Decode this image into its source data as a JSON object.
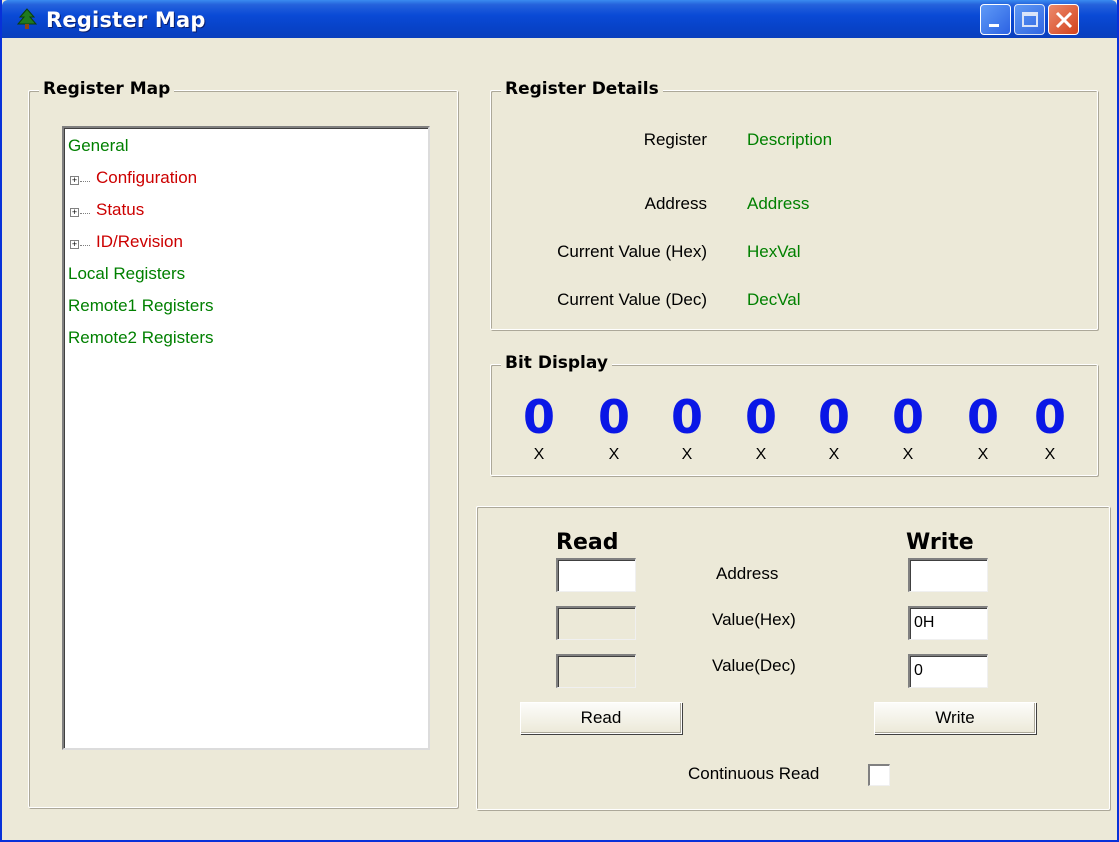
{
  "window": {
    "title": "Register Map"
  },
  "titlebar": {
    "icons": [
      "tree-icon",
      "minimize-icon",
      "maximize-icon",
      "close-icon"
    ]
  },
  "register_map": {
    "label": "Register Map",
    "tree": [
      {
        "text": "General",
        "color": "#008000"
      },
      {
        "text": "Configuration",
        "color": "#cc0000"
      },
      {
        "text": "Status",
        "color": "#cc0000"
      },
      {
        "text": "ID/Revision",
        "color": "#cc0000"
      },
      {
        "text": "Local Registers",
        "color": "#008000"
      },
      {
        "text": "Remote1 Registers",
        "color": "#008000"
      },
      {
        "text": "Remote2 Registers",
        "color": "#008000"
      }
    ]
  },
  "register_details": {
    "label": "Register Details",
    "rows": [
      {
        "label": "Register",
        "value": "Description"
      },
      {
        "label": "Address",
        "value": "Address"
      },
      {
        "label": "Current Value (Hex)",
        "value": "HexVal"
      },
      {
        "label": "Current Value (Dec)",
        "value": "DecVal"
      }
    ]
  },
  "bit_display": {
    "label": "Bit Display",
    "bits": [
      "0",
      "0",
      "0",
      "0",
      "0",
      "0",
      "0",
      "0"
    ],
    "marks": [
      "X",
      "X",
      "X",
      "X",
      "X",
      "X",
      "X",
      "X"
    ]
  },
  "read_write": {
    "read_heading": "Read",
    "write_heading": "Write",
    "row_labels": [
      "Address",
      "Value(Hex)",
      "Value(Dec)"
    ],
    "read_values": [
      "",
      "",
      ""
    ],
    "write_values": [
      "",
      "0H",
      "0"
    ],
    "read_button": "Read",
    "write_button": "Write",
    "continuous_read_label": "Continuous Read",
    "continuous_read_checked": false
  }
}
